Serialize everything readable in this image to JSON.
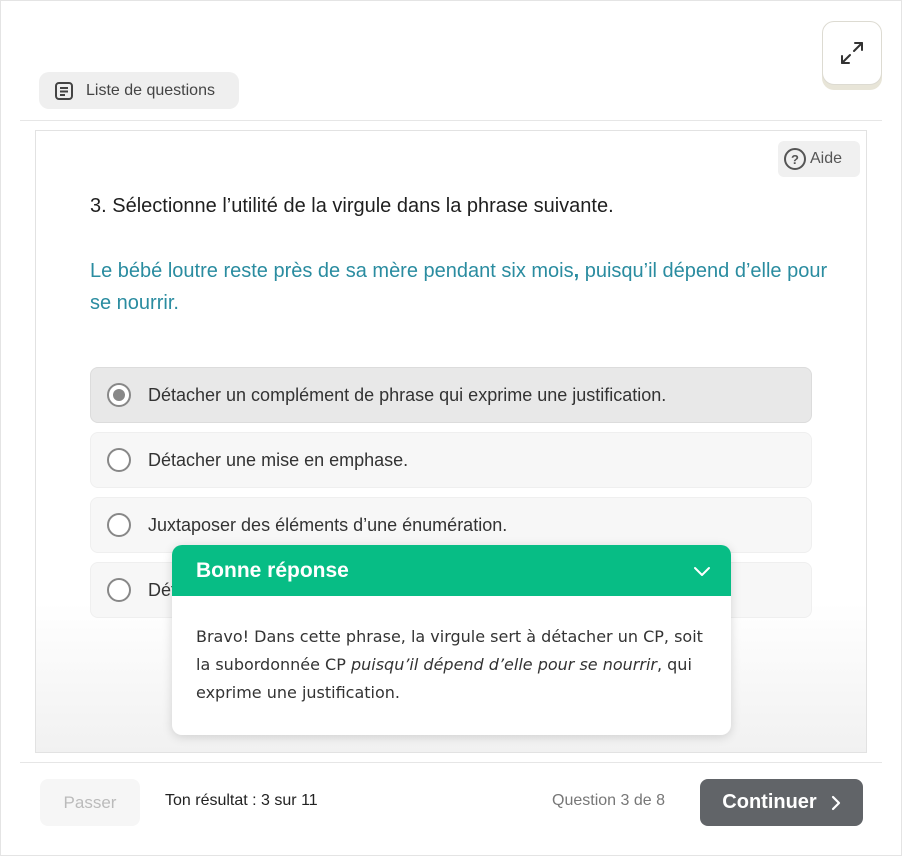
{
  "header": {
    "question_list_label": "Liste de questions",
    "expand_icon": "expand-arrows-icon"
  },
  "help": {
    "label": "Aide",
    "icon_glyph": "?"
  },
  "question": {
    "title": "3. Sélectionne l’utilité de la virgule dans la phrase suivante.",
    "sentence_before": "Le bébé loutre reste près de sa mère pendant six mois",
    "sentence_comma": ",",
    "sentence_after": " puisqu’il dépend d’elle pour se nourrir."
  },
  "options": [
    {
      "label": "Détacher un complément de phrase qui exprime une justification.",
      "selected": true
    },
    {
      "label": "Détacher une mise en emphase.",
      "selected": false
    },
    {
      "label": "Juxtaposer des éléments d’une énumération.",
      "selected": false
    },
    {
      "label": "Dét",
      "selected": false
    }
  ],
  "feedback": {
    "title": "Bonne réponse",
    "text_before": "Bravo! Dans cette phrase, la virgule sert à détacher un CP, soit la subordonnée CP ",
    "text_italic": "puisqu’il dépend d’elle pour se nourrir",
    "text_after": ", qui exprime une justification."
  },
  "footer": {
    "skip_label": "Passer",
    "result_label": "Ton résultat : 3 sur 11",
    "question_count": "Question 3 de 8",
    "continue_label": "Continuer"
  },
  "colors": {
    "accent_green": "#07bd85",
    "sentence_blue": "#2a8ca0",
    "continue_gray": "#616468"
  }
}
